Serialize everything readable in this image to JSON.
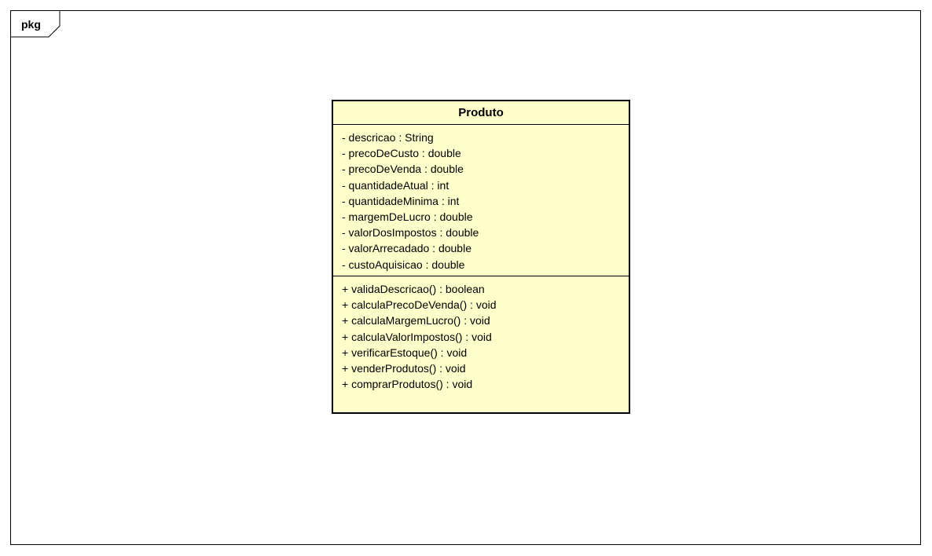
{
  "package": {
    "label": "pkg"
  },
  "class": {
    "name": "Produto",
    "attributes": [
      "- descricao : String",
      "- precoDeCusto : double",
      "- precoDeVenda : double",
      "- quantidadeAtual : int",
      "- quantidadeMinima : int",
      "- margemDeLucro : double",
      "- valorDosImpostos : double",
      "- valorArrecadado : double",
      "- custoAquisicao : double"
    ],
    "operations": [
      "+ validaDescricao() : boolean",
      "+ calculaPrecoDeVenda() : void",
      "+ calculaMargemLucro() : void",
      "+ calculaValorImpostos() : void",
      "+ verificarEstoque() : void",
      "+ venderProdutos() : void",
      "+ comprarProdutos() : void"
    ],
    "fill_color": "#ffffcc"
  }
}
